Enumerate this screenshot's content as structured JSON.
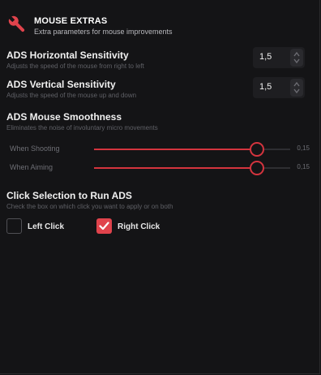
{
  "header": {
    "title": "MOUSE EXTRAS",
    "subtitle": "Extra parameters for mouse improvements",
    "icon": "wrench-icon",
    "accent": "#e0434c"
  },
  "ads_horizontal": {
    "label": "ADS Horizontal Sensitivity",
    "description": "Adjusts the speed of the mouse from right to left",
    "value": "1,5"
  },
  "ads_vertical": {
    "label": "ADS Vertical Sensitivity",
    "description": "Adjusts the speed of the mouse up and down",
    "value": "1,5"
  },
  "smoothness": {
    "label": "ADS Mouse Smoothness",
    "description": "Eliminates the noise of involuntary micro movements",
    "sliders": [
      {
        "label": "When Shooting",
        "value": "0,15",
        "fraction": 0.83
      },
      {
        "label": "When Aiming",
        "value": "0,15",
        "fraction": 0.83
      }
    ]
  },
  "click_selection": {
    "label": "Click Selection to Run ADS",
    "description": "Check the box on which click you want to apply or on both",
    "options": [
      {
        "label": "Left Click",
        "checked": false
      },
      {
        "label": "Right Click",
        "checked": true
      }
    ]
  }
}
